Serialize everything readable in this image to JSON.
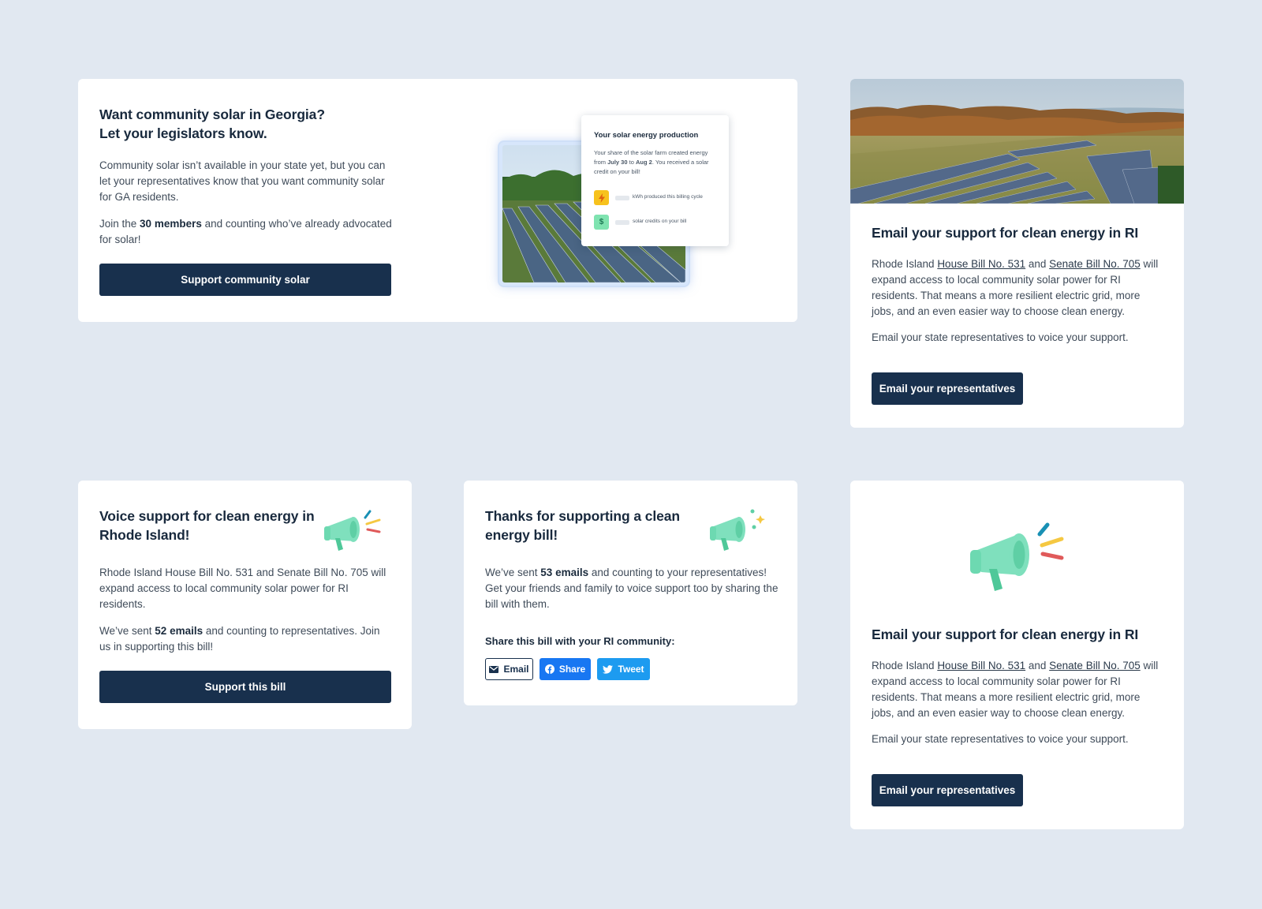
{
  "card1": {
    "title_line1": "Want community solar in Georgia?",
    "title_line2": "Let your legislators know.",
    "para1": "Community solar isn’t available in your state yet, but you can let your representatives know that you want community solar for GA residents.",
    "para2_pre": "Join the ",
    "para2_bold": "30 members",
    "para2_post": " and counting who’ve already advocated for solar!",
    "button": "Support community solar",
    "preview": {
      "title": "Your solar energy production",
      "text_pre": "Your share of the solar farm created energy from ",
      "date_from": "July 30",
      "text_mid": " to ",
      "date_to": "Aug 2",
      "text_post": ". You received a solar credit on your bill!",
      "row1_label": "kWh produced this billing cycle",
      "row2_label": "solar credits on your bill",
      "row2_symbol": "$"
    }
  },
  "card2": {
    "title": "Email your support for clean energy in RI",
    "para1_pre": "Rhode Island ",
    "link1": "House Bill No. 531",
    "para1_mid": " and ",
    "link2": "Senate Bill No. 705",
    "para1_post": " will expand access to local community solar power for RI residents. That means a more resilient electric grid, more jobs, and an even easier way to choose clean energy.",
    "para2": "Email your state representatives to voice your support.",
    "button": "Email your representatives"
  },
  "card3": {
    "title_line1": "Voice support for clean energy in",
    "title_line2": "Rhode Island!",
    "para1": "Rhode Island House Bill No. 531 and Senate Bill No. 705 will expand access to local community solar power for RI residents.",
    "para2_pre": "We’ve sent ",
    "para2_bold": "52 emails",
    "para2_post": " and counting to representatives. Join us in supporting this bill!",
    "button": "Support this bill"
  },
  "card4": {
    "title_line1": "Thanks for supporting a clean",
    "title_line2": "energy bill!",
    "para1_pre": "We’ve sent ",
    "para1_bold": "53 emails",
    "para1_post": " and counting to your representatives! Get your friends and family to voice support too by sharing the bill with them.",
    "share_label": "Share this bill with your RI community:",
    "share_email": "Email",
    "share_facebook": "Share",
    "share_twitter": "Tweet"
  },
  "card5": {
    "title": "Email your support for clean energy in RI",
    "para1_pre": "Rhode Island ",
    "link1": "House Bill No. 531",
    "para1_mid": " and ",
    "link2": "Senate Bill No. 705",
    "para1_post": " will expand access to local community solar power for RI residents. That means a more resilient electric grid, more jobs, and an even easier way to choose clean energy.",
    "para2": "Email your state representatives to voice your support.",
    "button": "Email your representatives"
  },
  "colors": {
    "background": "#e1e8f1",
    "button": "#18304d",
    "megaphone": "#7fe0bd",
    "facebook": "#1877f2",
    "twitter": "#1d9bf0",
    "bolt": "#f7c21d",
    "dollar": "#7fe3b0"
  },
  "icons": [
    "megaphone-icon",
    "lightning-bolt-icon",
    "dollar-icon",
    "envelope-icon",
    "facebook-icon",
    "twitter-icon"
  ]
}
